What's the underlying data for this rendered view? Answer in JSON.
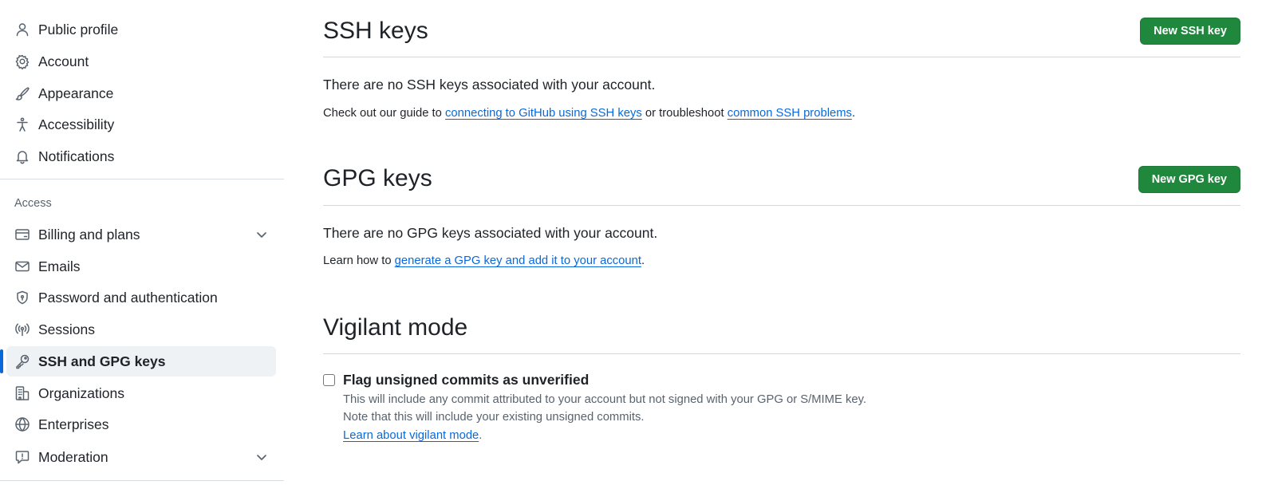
{
  "sidebar": {
    "items_top": [
      {
        "label": "Public profile",
        "icon": "person-icon"
      },
      {
        "label": "Account",
        "icon": "gear-icon"
      },
      {
        "label": "Appearance",
        "icon": "paintbrush-icon"
      },
      {
        "label": "Accessibility",
        "icon": "accessibility-icon"
      },
      {
        "label": "Notifications",
        "icon": "bell-icon"
      }
    ],
    "access_heading": "Access",
    "items_access": [
      {
        "label": "Billing and plans",
        "icon": "credit-card-icon",
        "expandable": true
      },
      {
        "label": "Emails",
        "icon": "mail-icon"
      },
      {
        "label": "Password and authentication",
        "icon": "shield-lock-icon"
      },
      {
        "label": "Sessions",
        "icon": "broadcast-icon"
      },
      {
        "label": "SSH and GPG keys",
        "icon": "key-icon",
        "active": true
      },
      {
        "label": "Organizations",
        "icon": "organization-icon"
      },
      {
        "label": "Enterprises",
        "icon": "globe-icon"
      },
      {
        "label": "Moderation",
        "icon": "report-icon",
        "expandable": true
      }
    ]
  },
  "ssh": {
    "title": "SSH keys",
    "button": "New SSH key",
    "empty": "There are no SSH keys associated with your account.",
    "help_prefix": "Check out our guide to ",
    "help_link1": "connecting to GitHub using SSH keys",
    "help_middle": " or troubleshoot ",
    "help_link2": "common SSH problems",
    "help_suffix": "."
  },
  "gpg": {
    "title": "GPG keys",
    "button": "New GPG key",
    "empty": "There are no GPG keys associated with your account.",
    "help_prefix": "Learn how to ",
    "help_link": "generate a GPG key and add it to your account",
    "help_suffix": "."
  },
  "vigilant": {
    "title": "Vigilant mode",
    "checkbox_label": "Flag unsigned commits as unverified",
    "note1": "This will include any commit attributed to your account but not signed with your GPG or S/MIME key.",
    "note2": "Note that this will include your existing unsigned commits.",
    "link": "Learn about vigilant mode",
    "link_suffix": "."
  },
  "colors": {
    "primary_button": "#1f883d",
    "link": "#0969da",
    "active_indicator": "#0969da"
  }
}
